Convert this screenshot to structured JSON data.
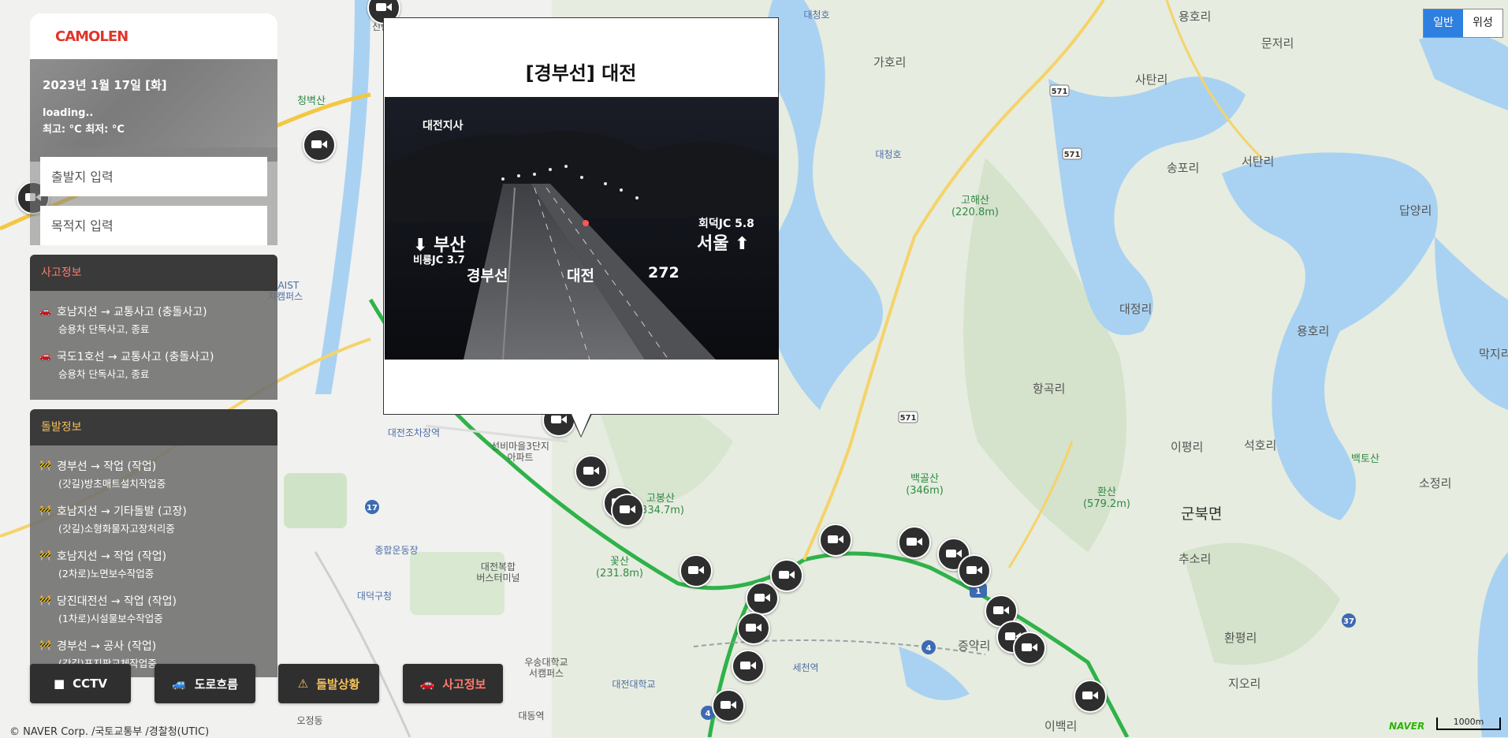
{
  "sidebar": {
    "logo_text": "CAMOLEN",
    "date": "2023년 1월 17일 [화]",
    "weather_status": "loading..",
    "temp_line": "최고: °C 최저: °C",
    "departure_placeholder": "출발지 입력",
    "destination_placeholder": "목적지 입력"
  },
  "accident": {
    "heading": "사고정보",
    "items": [
      {
        "title": "호남지선 → 교통사고 (충돌사고)",
        "desc": "승용차 단독사고, 종료"
      },
      {
        "title": "국도1호선 → 교통사고 (충돌사고)",
        "desc": "승용차 단독사고, 종료"
      }
    ]
  },
  "incident": {
    "heading": "돌발정보",
    "items": [
      {
        "title": "경부선 → 작업 (작업)",
        "desc": "(갓길)방초매트설치작업중"
      },
      {
        "title": "호남지선 → 기타돌발 (고장)",
        "desc": "(갓길)소형화물자고장처리중"
      },
      {
        "title": "호남지선 → 작업 (작업)",
        "desc": "(2차로)노면보수작업중"
      },
      {
        "title": "당진대전선 → 작업 (작업)",
        "desc": "(1차로)시설물보수작업중"
      },
      {
        "title": "경부선 → 공사 (작업)",
        "desc": "(갓길)표지판교체작업중"
      }
    ]
  },
  "bottom_buttons": {
    "cctv": "CCTV",
    "traffic": "도로흐름",
    "incident": "돌발상황",
    "accident": "사고정보"
  },
  "popup": {
    "title": "[경부선] 대전",
    "cctv_overlay": {
      "branch": "대전지사",
      "busan": "부산",
      "biryong": "비룡JC  3.7",
      "hoedeok": "회덕JC  5.8",
      "seoul": "서울",
      "road": "경부선",
      "place": "대전",
      "km": "272"
    }
  },
  "map_type": {
    "normal": "일반",
    "satellite": "위성"
  },
  "copyright": "© NAVER Corp. /국토교통부 /경찰청(UTIC)",
  "naver": "NAVER",
  "scale": "1000m",
  "map_labels": {
    "gahori": "가호리",
    "daecheongho": "대청호",
    "daecheongho2": "대청호",
    "sataeri": "사탄리",
    "songpori": "송포리",
    "seotanri": "서탄리",
    "dapyangri": "답양리",
    "munjeori": "문저리",
    "yonghori": "용호리",
    "yonghori2": "용호리",
    "daejeongri": "대정리",
    "hanggokri": "항곡리",
    "ipyeongri": "이평리",
    "seokhori": "석호리",
    "gunbukmyeon": "군북면",
    "chusori": "추소리",
    "sojeongri": "소정리",
    "hwanpyeongri": "환평리",
    "jeungyakri": "증약리",
    "jiori": "지오리",
    "ibaekri": "이백리",
    "makjiri": "막지리",
    "sirang": "청벽산",
    "gohaesan": "고해산\n(220.8m)",
    "baekgolsan": "백골산\n(346m)",
    "hwansan": "환산\n(579.2m)",
    "gobongsan": "고봉산\n(334.7m)",
    "kkotsan": "꽃산\n(231.8m)",
    "baektosan": "백토산",
    "seonbi": "선비마을3단지\n아파트",
    "daejeon_jochajang": "대전조차장역",
    "jonghap": "종합운동장",
    "bokhap": "대전복합\n버스터미널",
    "daedeokgu": "대덕구청",
    "usong": "우송대학교\n서캠퍼스",
    "daejeon_univ": "대전대학교",
    "sejeon": "세천역",
    "daedong": "대동역",
    "kaist": "KAIST\n지캠퍼스",
    "ojeong": "오정동",
    "sinhan": "신탄"
  }
}
